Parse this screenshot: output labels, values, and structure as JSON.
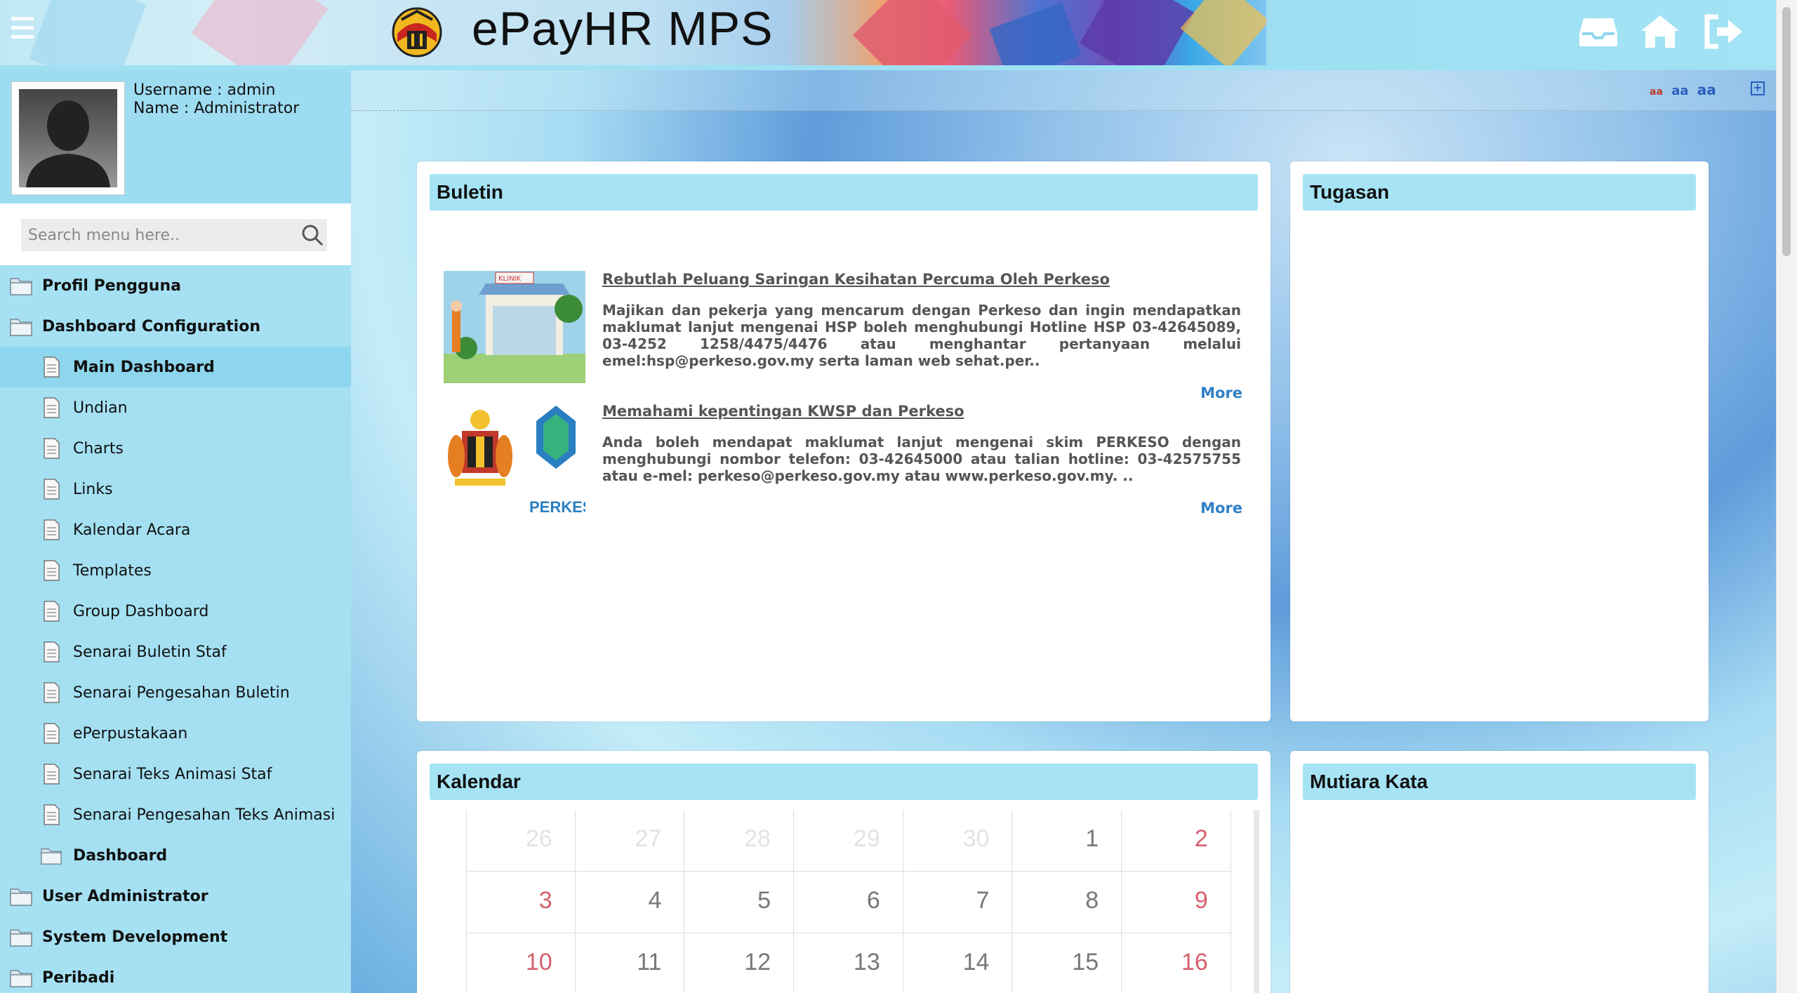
{
  "app": {
    "title": "ePayHR MPS"
  },
  "header": {
    "icons": [
      "inbox-icon",
      "home-icon",
      "logout-icon"
    ]
  },
  "profile": {
    "username_label": "Username : admin",
    "name_label": "Name : Administrator"
  },
  "search": {
    "placeholder": "Search menu here.."
  },
  "menu": {
    "items": [
      {
        "label": "Profil Pengguna",
        "level": 0,
        "icon": "folder-icon"
      },
      {
        "label": "Dashboard Configuration",
        "level": 0,
        "icon": "folder-icon"
      },
      {
        "label": "Main Dashboard",
        "level": 1,
        "icon": "page-icon",
        "active": true
      },
      {
        "label": "Undian",
        "level": 1,
        "icon": "page-icon"
      },
      {
        "label": "Charts",
        "level": 1,
        "icon": "page-icon"
      },
      {
        "label": "Links",
        "level": 1,
        "icon": "page-icon"
      },
      {
        "label": "Kalendar Acara",
        "level": 1,
        "icon": "page-icon"
      },
      {
        "label": "Templates",
        "level": 1,
        "icon": "page-icon"
      },
      {
        "label": "Group Dashboard",
        "level": 1,
        "icon": "page-icon"
      },
      {
        "label": "Senarai Buletin Staf",
        "level": 1,
        "icon": "page-icon"
      },
      {
        "label": "Senarai Pengesahan Buletin",
        "level": 1,
        "icon": "page-icon"
      },
      {
        "label": "ePerpustakaan",
        "level": 1,
        "icon": "page-icon"
      },
      {
        "label": "Senarai Teks Animasi Staf",
        "level": 1,
        "icon": "page-icon"
      },
      {
        "label": "Senarai Pengesahan Teks Animasi",
        "level": 1,
        "icon": "page-icon"
      },
      {
        "label": "Dashboard",
        "level": 1,
        "icon": "folder-icon"
      },
      {
        "label": "User Administrator",
        "level": 0,
        "icon": "folder-icon"
      },
      {
        "label": "System Development",
        "level": 0,
        "icon": "folder-icon"
      },
      {
        "label": "Peribadi",
        "level": 0,
        "icon": "folder-icon"
      }
    ]
  },
  "toolbar": {
    "font_sizes": [
      "aa",
      "aa",
      "aa"
    ]
  },
  "buletin": {
    "title": "Buletin",
    "items": [
      {
        "title": "Rebutlah Peluang Saringan Kesihatan Percuma Oleh Perkeso",
        "body": "Majikan dan pekerja yang mencarum dengan Perkeso dan ingin mendapatkan maklumat lanjut mengenai HSP boleh menghubungi Hotline HSP 03-42645089, 03-4252 1258/4475/4476 atau menghantar pertanyaan melalui emel:hsp@perkeso.gov.my serta laman web sehat.per..",
        "more": "More",
        "image_label": "KLINIK"
      },
      {
        "title": "Memahami kepentingan KWSP dan Perkeso",
        "body": "Anda boleh mendapat maklumat lanjut mengenai skim PERKESO dengan menghubungi nombor telefon: 03-42645000 atau talian hotline: 03-42575755 atau e-mel: perkeso@perkeso.gov.my atau www.perkeso.gov.my. ..",
        "more": "More",
        "image_label": "PERKESO"
      }
    ]
  },
  "tugasan": {
    "title": "Tugasan"
  },
  "kalendar": {
    "title": "Kalendar",
    "weeks": [
      [
        {
          "d": "26",
          "other": true
        },
        {
          "d": "27",
          "other": true
        },
        {
          "d": "28",
          "other": true
        },
        {
          "d": "29",
          "other": true
        },
        {
          "d": "30",
          "other": true
        },
        {
          "d": "1"
        },
        {
          "d": "2",
          "weekend": true
        }
      ],
      [
        {
          "d": "3",
          "weekend": true
        },
        {
          "d": "4"
        },
        {
          "d": "5"
        },
        {
          "d": "6"
        },
        {
          "d": "7"
        },
        {
          "d": "8"
        },
        {
          "d": "9",
          "weekend": true
        }
      ],
      [
        {
          "d": "10",
          "weekend": true
        },
        {
          "d": "11"
        },
        {
          "d": "12"
        },
        {
          "d": "13"
        },
        {
          "d": "14"
        },
        {
          "d": "15"
        },
        {
          "d": "16",
          "weekend": true
        }
      ]
    ]
  },
  "mutiara": {
    "title": "Mutiara Kata"
  },
  "colors": {
    "header_bg": "#a0dcf1",
    "sidebar_bg": "#a3e0f3",
    "panel_title_bg": "#a6e4f5",
    "more_link": "#2f80c7",
    "weekend": "#d5606c"
  }
}
